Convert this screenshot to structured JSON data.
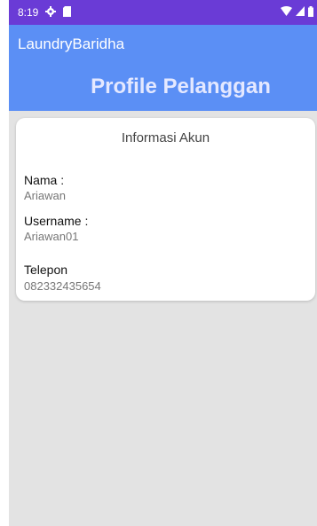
{
  "status_bar": {
    "time": "8:19",
    "icons": [
      "settings-icon",
      "sim-card-icon",
      "wifi-icon",
      "signal-icon",
      "battery-icon"
    ]
  },
  "app_bar": {
    "title": "LaundryBaridha"
  },
  "header": {
    "title": "Profile Pelanggan"
  },
  "card": {
    "title": "Informasi Akun",
    "fields": [
      {
        "label": "Nama :",
        "value": "Ariawan"
      },
      {
        "label": "Username :",
        "value": "Ariawan01"
      },
      {
        "label": "Telepon",
        "value": "082332435654"
      }
    ]
  },
  "colors": {
    "status_bar": "#6a3bd6",
    "app_bar": "#5b8ff5",
    "header": "#5b8ff5",
    "background": "#e3e3e3"
  }
}
